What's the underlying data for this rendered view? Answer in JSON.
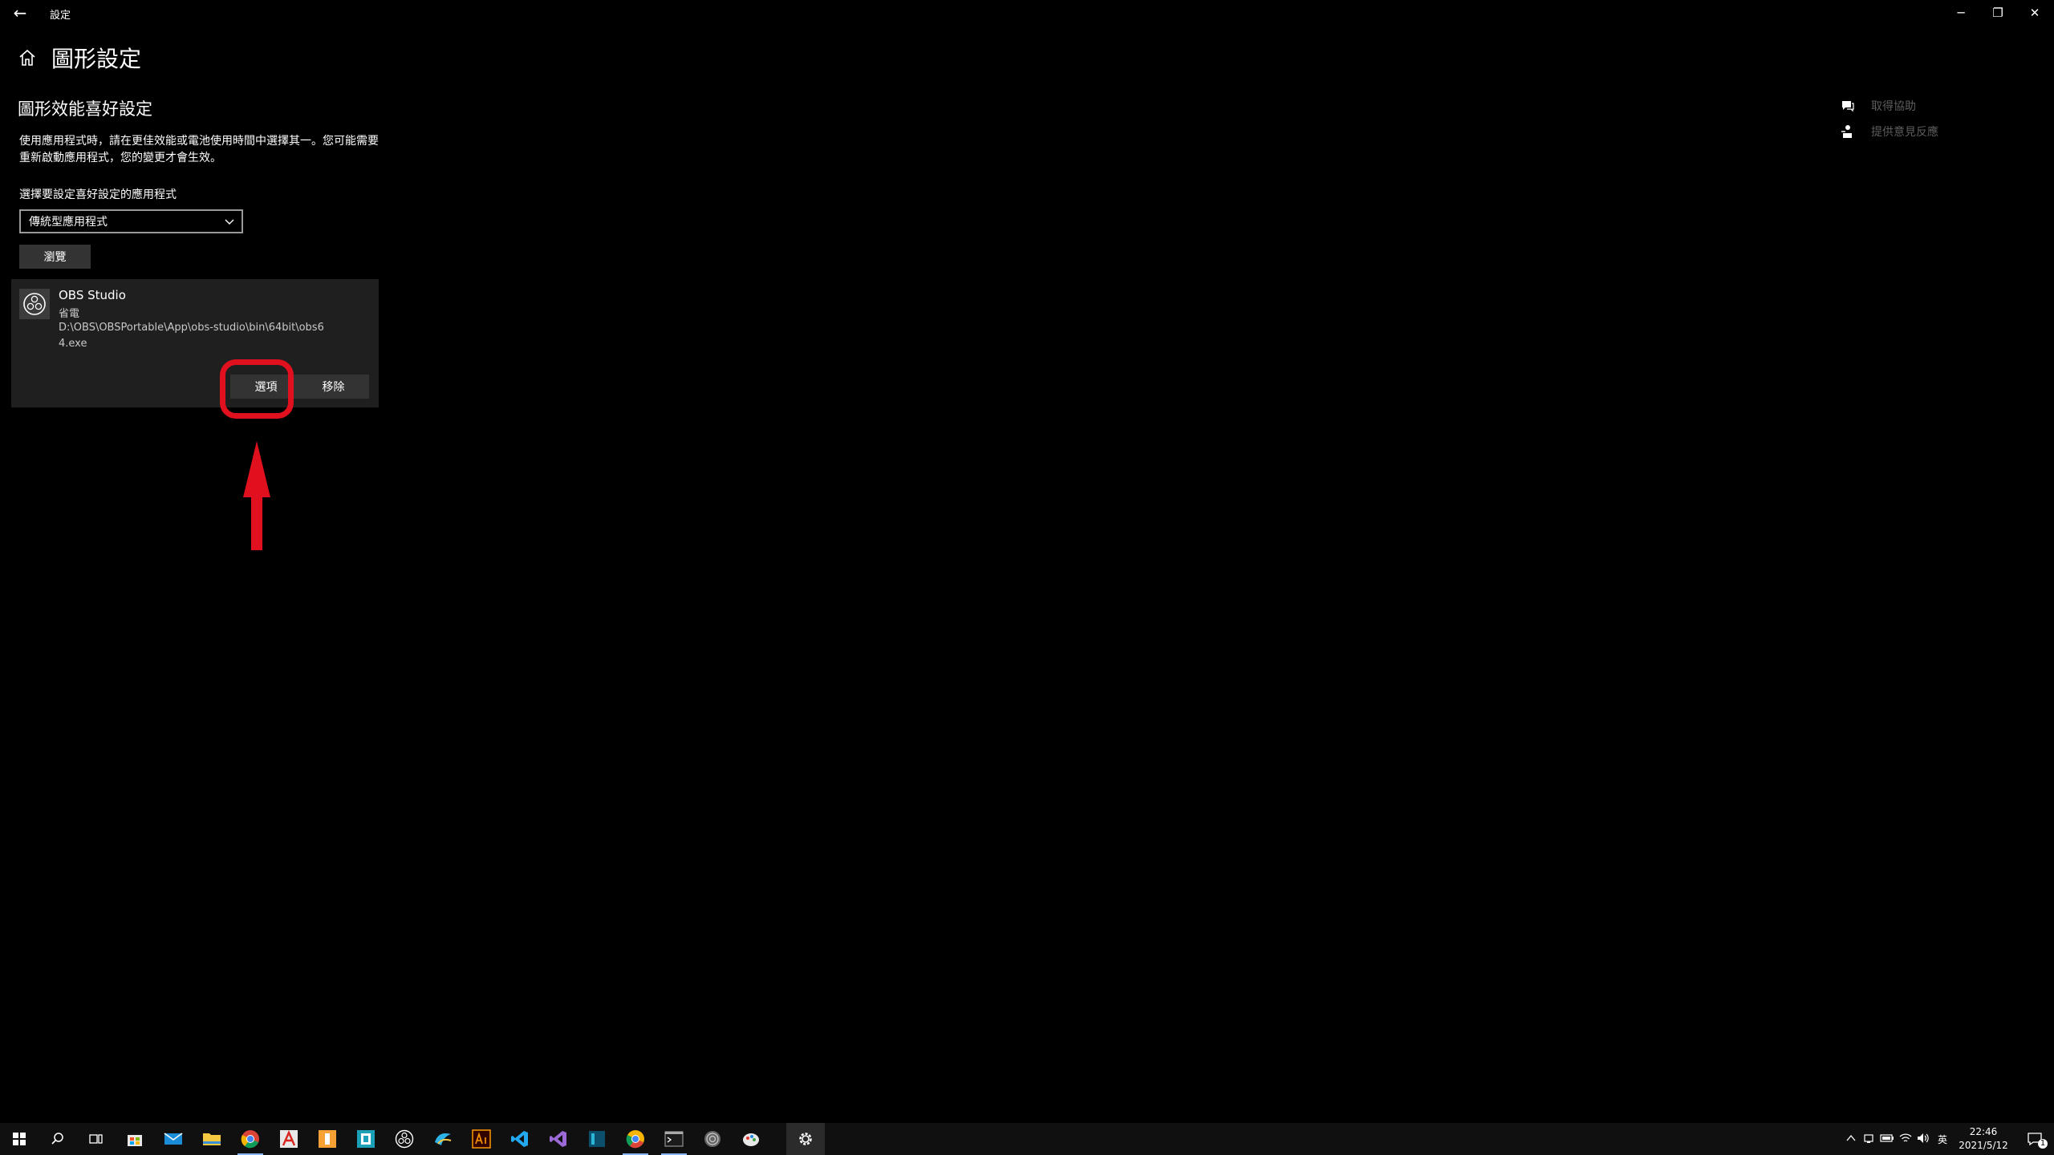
{
  "window": {
    "title": "設定",
    "back_glyph": "←",
    "minimize_glyph": "─",
    "restore_glyph": "❐",
    "close_glyph": "✕"
  },
  "page": {
    "title": "圖形設定",
    "section_title": "圖形效能喜好設定",
    "description": "使用應用程式時，請在更佳效能或電池使用時間中選擇其一。您可能需要重新啟動應用程式，您的變更才會生效。",
    "select_label": "選擇要設定喜好設定的應用程式",
    "dropdown_value": "傳統型應用程式",
    "browse_label": "瀏覽"
  },
  "app_card": {
    "name": "OBS Studio",
    "mode": "省電",
    "path": "D:\\OBS\\OBSPortable\\App\\obs-studio\\bin\\64bit\\obs64.exe",
    "options_label": "選項",
    "remove_label": "移除"
  },
  "help": {
    "get_help": "取得協助",
    "give_feedback": "提供意見反應"
  },
  "taskbar": {
    "time": "22:46",
    "date": "2021/5/12",
    "ime": "英",
    "notifications": "1"
  },
  "colors": {
    "background": "#000000",
    "card": "#1f1f1f",
    "button": "#333333",
    "annotation": "#e0101e",
    "muted_text": "#5d5d5d"
  }
}
